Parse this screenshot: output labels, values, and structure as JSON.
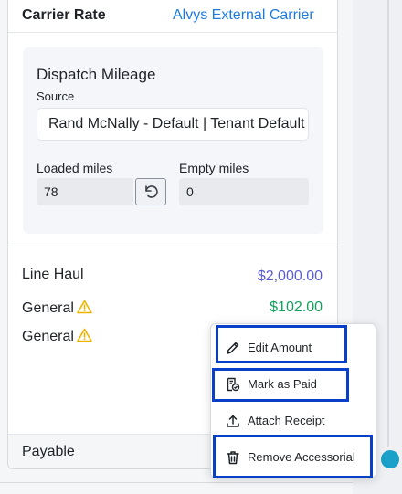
{
  "header": {
    "title": "Carrier Rate",
    "carrier_link": "Alvys External Carrier"
  },
  "mileage": {
    "title": "Dispatch Mileage",
    "source_label": "Source",
    "source_value": "Rand McNally - Default | Tenant Default",
    "loaded_label": "Loaded miles",
    "loaded_value": "78",
    "empty_label": "Empty miles",
    "empty_value": "0"
  },
  "charges": [
    {
      "label": "Line Haul",
      "amount": "$2,000.00",
      "color": "#5b5bd6"
    },
    {
      "label": "General",
      "amount": "$102.00",
      "color": "#12a05c",
      "warning": true
    },
    {
      "label": "General",
      "amount": "",
      "warning": true
    }
  ],
  "footer": {
    "payable_label": "Payable"
  },
  "context_menu": {
    "items": [
      {
        "label": "Edit Amount",
        "icon": "pencil-icon"
      },
      {
        "label": "Mark as Paid",
        "icon": "receipt-check-icon"
      },
      {
        "label": "Attach Receipt",
        "icon": "upload-icon"
      },
      {
        "label": "Remove Accessorial",
        "icon": "trash-icon"
      }
    ]
  },
  "colors": {
    "link": "#1f7ae0",
    "warning": "#f0b400",
    "highlight": "#0a3fc7",
    "accent_dot": "#1aa0c9"
  }
}
